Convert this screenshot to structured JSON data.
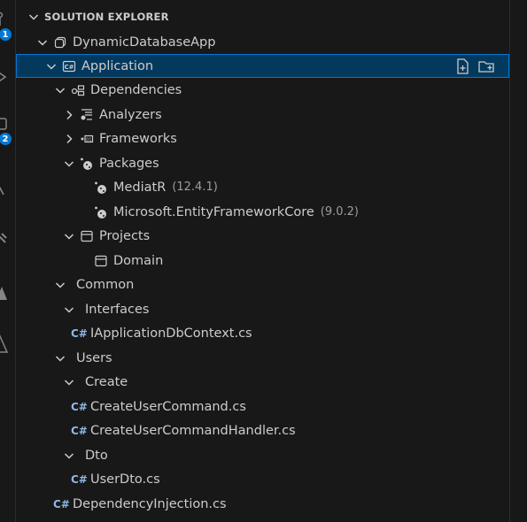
{
  "explorer": {
    "title": "SOLUTION EXPLORER"
  },
  "activity_bar": {
    "badges": [
      "1",
      "2"
    ]
  },
  "tree": [
    {
      "label": "DynamicDatabaseApp",
      "icon": "solution-icon",
      "expanded": true
    },
    {
      "label": "Application",
      "icon": "csharp-project-icon",
      "expanded": true,
      "selected": true
    },
    {
      "label": "Dependencies",
      "icon": "dependencies-icon",
      "expanded": true
    },
    {
      "label": "Analyzers",
      "icon": "analyzers-icon",
      "expanded": false
    },
    {
      "label": "Frameworks",
      "icon": "frameworks-icon",
      "expanded": false
    },
    {
      "label": "Packages",
      "icon": "package-icon",
      "expanded": true
    },
    {
      "label": "MediatR",
      "version": "(12.4.1)",
      "icon": "package-icon"
    },
    {
      "label": "Microsoft.EntityFrameworkCore",
      "version": "(9.0.2)",
      "icon": "package-icon"
    },
    {
      "label": "Projects",
      "icon": "project-icon",
      "expanded": true
    },
    {
      "label": "Domain",
      "icon": "project-icon"
    },
    {
      "label": "Common",
      "icon": "none",
      "expanded": true
    },
    {
      "label": "Interfaces",
      "icon": "none",
      "expanded": true
    },
    {
      "label": "IApplicationDbContext.cs",
      "icon": "csharp-file-icon"
    },
    {
      "label": "Users",
      "icon": "none",
      "expanded": true
    },
    {
      "label": "Create",
      "icon": "none",
      "expanded": true
    },
    {
      "label": "CreateUserCommand.cs",
      "icon": "csharp-file-icon"
    },
    {
      "label": "CreateUserCommandHandler.cs",
      "icon": "csharp-file-icon"
    },
    {
      "label": "Dto",
      "icon": "none",
      "expanded": true
    },
    {
      "label": "UserDto.cs",
      "icon": "csharp-file-icon"
    },
    {
      "label": "DependencyInjection.cs",
      "icon": "csharp-file-icon"
    }
  ],
  "colors": {
    "background": "#181818",
    "selection": "#04395e",
    "selection_border": "#0078d4",
    "csharp_glyph": "#8fb8e8",
    "badge": "#0078d4"
  }
}
